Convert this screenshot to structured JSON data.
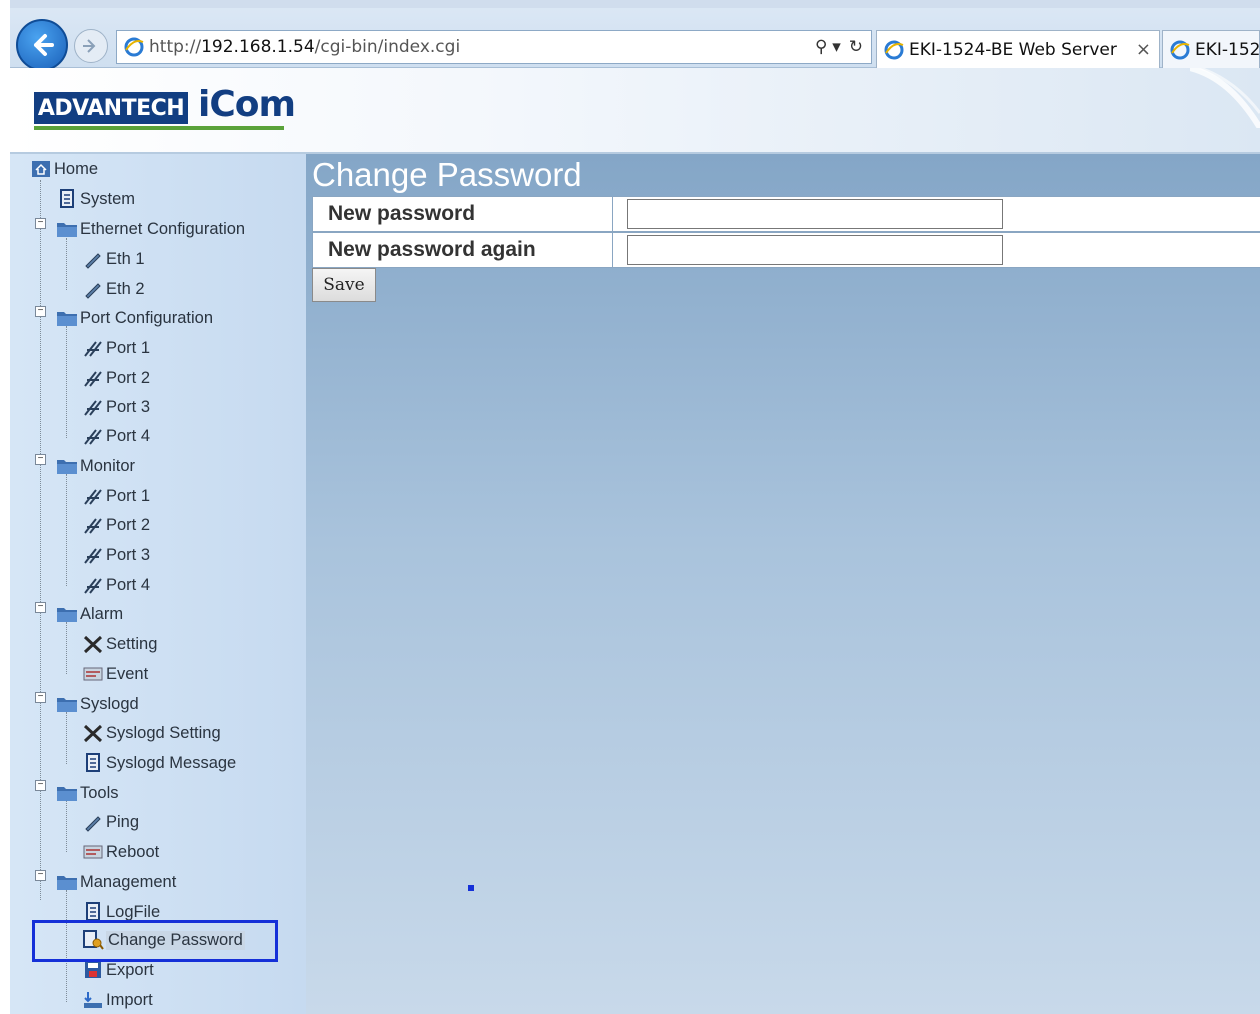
{
  "browser": {
    "url_prefix": "http://",
    "url_host": "192.168.1.54",
    "url_path": "/cgi-bin/index.cgi",
    "tabs": [
      {
        "label": "EKI-1524-BE Web Server",
        "active": true
      },
      {
        "label": "EKI-152",
        "active": false
      }
    ],
    "tab_close": "×",
    "search_glyph": "⚲ ▾",
    "refresh_glyph": "↻"
  },
  "header": {
    "logo_left": "ADVANTECH",
    "logo_right": "iCom"
  },
  "sidebar": {
    "items": [
      {
        "label": "Home",
        "icon": "home-icon",
        "level": 0
      },
      {
        "label": "System",
        "icon": "document-icon",
        "level": 1
      },
      {
        "label": "Ethernet Configuration",
        "icon": "folder-icon",
        "level": 1
      },
      {
        "label": "Eth 1",
        "icon": "pen-icon",
        "level": 2
      },
      {
        "label": "Eth 2",
        "icon": "pen-icon",
        "level": 2
      },
      {
        "label": "Port Configuration",
        "icon": "folder-icon",
        "level": 1
      },
      {
        "label": "Port 1",
        "icon": "tools-icon",
        "level": 2
      },
      {
        "label": "Port 2",
        "icon": "tools-icon",
        "level": 2
      },
      {
        "label": "Port 3",
        "icon": "tools-icon",
        "level": 2
      },
      {
        "label": "Port 4",
        "icon": "tools-icon",
        "level": 2
      },
      {
        "label": "Monitor",
        "icon": "folder-icon",
        "level": 1
      },
      {
        "label": "Port 1",
        "icon": "tools-icon",
        "level": 2
      },
      {
        "label": "Port 2",
        "icon": "tools-icon",
        "level": 2
      },
      {
        "label": "Port 3",
        "icon": "tools-icon",
        "level": 2
      },
      {
        "label": "Port 4",
        "icon": "tools-icon",
        "level": 2
      },
      {
        "label": "Alarm",
        "icon": "folder-icon",
        "level": 1
      },
      {
        "label": "Setting",
        "icon": "wrench-icon",
        "level": 2
      },
      {
        "label": "Event",
        "icon": "event-icon",
        "level": 2
      },
      {
        "label": "Syslogd",
        "icon": "folder-icon",
        "level": 1
      },
      {
        "label": "Syslogd Setting",
        "icon": "wrench-icon",
        "level": 2
      },
      {
        "label": "Syslogd Message",
        "icon": "document-icon",
        "level": 2
      },
      {
        "label": "Tools",
        "icon": "folder-icon",
        "level": 1
      },
      {
        "label": "Ping",
        "icon": "pen-icon",
        "level": 2
      },
      {
        "label": "Reboot",
        "icon": "event-icon",
        "level": 2
      },
      {
        "label": "Management",
        "icon": "folder-icon",
        "level": 1
      },
      {
        "label": "LogFile",
        "icon": "document-icon",
        "level": 2
      },
      {
        "label": "Change Password",
        "icon": "key-icon",
        "level": 2,
        "selected": true
      },
      {
        "label": "Export",
        "icon": "save-icon",
        "level": 2
      },
      {
        "label": "Import",
        "icon": "import-icon",
        "level": 2
      }
    ]
  },
  "main": {
    "title": "Change Password",
    "fields": [
      {
        "label": "New password",
        "value": ""
      },
      {
        "label": "New password again",
        "value": ""
      }
    ],
    "save_label": "Save"
  },
  "colors": {
    "highlight": "#1530d8",
    "logo_blue": "#123e82",
    "logo_green": "#5aa23a"
  }
}
